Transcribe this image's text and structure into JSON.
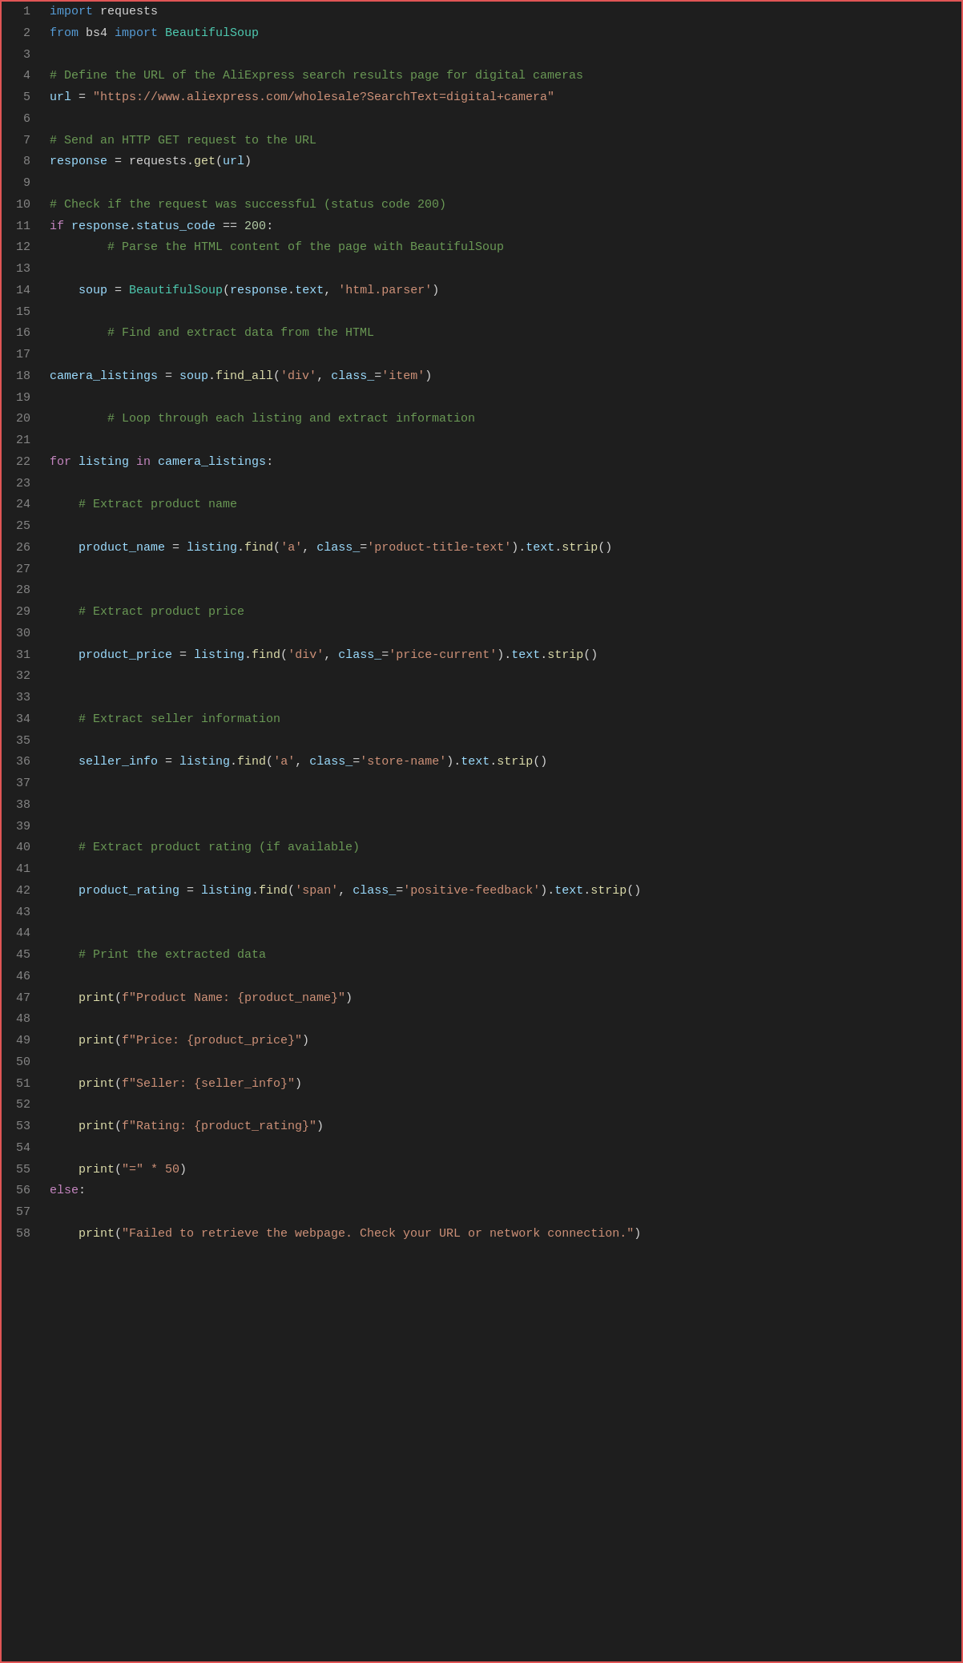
{
  "editor": {
    "background": "#1e1e1e",
    "border_color": "#e05555",
    "lines": [
      {
        "num": 1,
        "tokens": [
          {
            "t": "kw",
            "v": "import"
          },
          {
            "t": "plain",
            "v": " requests"
          }
        ]
      },
      {
        "num": 2,
        "tokens": [
          {
            "t": "kw",
            "v": "from"
          },
          {
            "t": "plain",
            "v": " bs4 "
          },
          {
            "t": "kw",
            "v": "import"
          },
          {
            "t": "plain",
            "v": " "
          },
          {
            "t": "cls",
            "v": "BeautifulSoup"
          }
        ]
      },
      {
        "num": 3,
        "tokens": []
      },
      {
        "num": 4,
        "tokens": [
          {
            "t": "cmt",
            "v": "# Define the URL of the AliExpress search results page for digital cameras"
          }
        ]
      },
      {
        "num": 5,
        "tokens": [
          {
            "t": "var",
            "v": "url"
          },
          {
            "t": "plain",
            "v": " = "
          },
          {
            "t": "str",
            "v": "\"https://www.aliexpress.com/wholesale?SearchText=digital+camera\""
          }
        ]
      },
      {
        "num": 6,
        "tokens": []
      },
      {
        "num": 7,
        "tokens": [
          {
            "t": "cmt",
            "v": "# Send an HTTP GET request to the URL"
          }
        ]
      },
      {
        "num": 8,
        "tokens": [
          {
            "t": "var",
            "v": "response"
          },
          {
            "t": "plain",
            "v": " = requests."
          },
          {
            "t": "fn",
            "v": "get"
          },
          {
            "t": "plain",
            "v": "("
          },
          {
            "t": "var",
            "v": "url"
          },
          {
            "t": "plain",
            "v": ")"
          }
        ]
      },
      {
        "num": 9,
        "tokens": []
      },
      {
        "num": 10,
        "tokens": [
          {
            "t": "cmt",
            "v": "# Check if the request was successful (status code 200)"
          }
        ]
      },
      {
        "num": 11,
        "tokens": [
          {
            "t": "kw2",
            "v": "if"
          },
          {
            "t": "plain",
            "v": " "
          },
          {
            "t": "var",
            "v": "response"
          },
          {
            "t": "plain",
            "v": "."
          },
          {
            "t": "var",
            "v": "status_code"
          },
          {
            "t": "plain",
            "v": " == "
          },
          {
            "t": "num",
            "v": "200"
          },
          {
            "t": "plain",
            "v": ":"
          }
        ]
      },
      {
        "num": 12,
        "tokens": [
          {
            "t": "plain",
            "v": "        "
          },
          {
            "t": "cmt",
            "v": "# Parse the HTML content of the page with BeautifulSoup"
          }
        ]
      },
      {
        "num": 13,
        "tokens": []
      },
      {
        "num": 14,
        "tokens": [
          {
            "t": "plain",
            "v": "    "
          },
          {
            "t": "var",
            "v": "soup"
          },
          {
            "t": "plain",
            "v": " = "
          },
          {
            "t": "cls",
            "v": "BeautifulSoup"
          },
          {
            "t": "plain",
            "v": "("
          },
          {
            "t": "var",
            "v": "response"
          },
          {
            "t": "plain",
            "v": "."
          },
          {
            "t": "var",
            "v": "text"
          },
          {
            "t": "plain",
            "v": ", "
          },
          {
            "t": "str",
            "v": "'html.parser'"
          },
          {
            "t": "plain",
            "v": ")"
          }
        ]
      },
      {
        "num": 15,
        "tokens": []
      },
      {
        "num": 16,
        "tokens": [
          {
            "t": "plain",
            "v": "        "
          },
          {
            "t": "cmt",
            "v": "# Find and extract data from the HTML"
          }
        ]
      },
      {
        "num": 17,
        "tokens": []
      },
      {
        "num": 18,
        "tokens": [
          {
            "t": "var",
            "v": "camera_listings"
          },
          {
            "t": "plain",
            "v": " = "
          },
          {
            "t": "var",
            "v": "soup"
          },
          {
            "t": "plain",
            "v": "."
          },
          {
            "t": "fn",
            "v": "find_all"
          },
          {
            "t": "plain",
            "v": "("
          },
          {
            "t": "str",
            "v": "'div'"
          },
          {
            "t": "plain",
            "v": ", "
          },
          {
            "t": "var",
            "v": "class_"
          },
          {
            "t": "plain",
            "v": "="
          },
          {
            "t": "str",
            "v": "'item'"
          },
          {
            "t": "plain",
            "v": ")"
          }
        ]
      },
      {
        "num": 19,
        "tokens": []
      },
      {
        "num": 20,
        "tokens": [
          {
            "t": "plain",
            "v": "        "
          },
          {
            "t": "cmt",
            "v": "# Loop through each listing and extract information"
          }
        ]
      },
      {
        "num": 21,
        "tokens": []
      },
      {
        "num": 22,
        "tokens": [
          {
            "t": "kw2",
            "v": "for"
          },
          {
            "t": "plain",
            "v": " "
          },
          {
            "t": "var",
            "v": "listing"
          },
          {
            "t": "plain",
            "v": " "
          },
          {
            "t": "kw2",
            "v": "in"
          },
          {
            "t": "plain",
            "v": " "
          },
          {
            "t": "var",
            "v": "camera_listings"
          },
          {
            "t": "plain",
            "v": ":"
          }
        ]
      },
      {
        "num": 23,
        "tokens": []
      },
      {
        "num": 24,
        "tokens": [
          {
            "t": "plain",
            "v": "    "
          },
          {
            "t": "cmt",
            "v": "# Extract product name"
          }
        ]
      },
      {
        "num": 25,
        "tokens": []
      },
      {
        "num": 26,
        "tokens": [
          {
            "t": "plain",
            "v": "    "
          },
          {
            "t": "var",
            "v": "product_name"
          },
          {
            "t": "plain",
            "v": " = "
          },
          {
            "t": "var",
            "v": "listing"
          },
          {
            "t": "plain",
            "v": "."
          },
          {
            "t": "fn",
            "v": "find"
          },
          {
            "t": "plain",
            "v": "("
          },
          {
            "t": "str",
            "v": "'a'"
          },
          {
            "t": "plain",
            "v": ", "
          },
          {
            "t": "var",
            "v": "class_"
          },
          {
            "t": "plain",
            "v": "="
          },
          {
            "t": "str",
            "v": "'product-title-text'"
          },
          {
            "t": "plain",
            "v": ")."
          },
          {
            "t": "var",
            "v": "text"
          },
          {
            "t": "plain",
            "v": "."
          },
          {
            "t": "fn",
            "v": "strip"
          },
          {
            "t": "plain",
            "v": "()"
          }
        ]
      },
      {
        "num": 27,
        "tokens": []
      },
      {
        "num": 28,
        "tokens": []
      },
      {
        "num": 29,
        "tokens": [
          {
            "t": "plain",
            "v": "    "
          },
          {
            "t": "cmt",
            "v": "# Extract product price"
          }
        ]
      },
      {
        "num": 30,
        "tokens": []
      },
      {
        "num": 31,
        "tokens": [
          {
            "t": "plain",
            "v": "    "
          },
          {
            "t": "var",
            "v": "product_price"
          },
          {
            "t": "plain",
            "v": " = "
          },
          {
            "t": "var",
            "v": "listing"
          },
          {
            "t": "plain",
            "v": "."
          },
          {
            "t": "fn",
            "v": "find"
          },
          {
            "t": "plain",
            "v": "("
          },
          {
            "t": "str",
            "v": "'div'"
          },
          {
            "t": "plain",
            "v": ", "
          },
          {
            "t": "var",
            "v": "class_"
          },
          {
            "t": "plain",
            "v": "="
          },
          {
            "t": "str",
            "v": "'price-current'"
          },
          {
            "t": "plain",
            "v": ")."
          },
          {
            "t": "var",
            "v": "text"
          },
          {
            "t": "plain",
            "v": "."
          },
          {
            "t": "fn",
            "v": "strip"
          },
          {
            "t": "plain",
            "v": "()"
          }
        ]
      },
      {
        "num": 32,
        "tokens": []
      },
      {
        "num": 33,
        "tokens": []
      },
      {
        "num": 34,
        "tokens": [
          {
            "t": "plain",
            "v": "    "
          },
          {
            "t": "cmt",
            "v": "# Extract seller information"
          }
        ]
      },
      {
        "num": 35,
        "tokens": []
      },
      {
        "num": 36,
        "tokens": [
          {
            "t": "plain",
            "v": "    "
          },
          {
            "t": "var",
            "v": "seller_info"
          },
          {
            "t": "plain",
            "v": " = "
          },
          {
            "t": "var",
            "v": "listing"
          },
          {
            "t": "plain",
            "v": "."
          },
          {
            "t": "fn",
            "v": "find"
          },
          {
            "t": "plain",
            "v": "("
          },
          {
            "t": "str",
            "v": "'a'"
          },
          {
            "t": "plain",
            "v": ", "
          },
          {
            "t": "var",
            "v": "class_"
          },
          {
            "t": "plain",
            "v": "="
          },
          {
            "t": "str",
            "v": "'store-name'"
          },
          {
            "t": "plain",
            "v": ")."
          },
          {
            "t": "var",
            "v": "text"
          },
          {
            "t": "plain",
            "v": "."
          },
          {
            "t": "fn",
            "v": "strip"
          },
          {
            "t": "plain",
            "v": "()"
          }
        ]
      },
      {
        "num": 37,
        "tokens": []
      },
      {
        "num": 38,
        "tokens": []
      },
      {
        "num": 39,
        "tokens": []
      },
      {
        "num": 40,
        "tokens": [
          {
            "t": "plain",
            "v": "    "
          },
          {
            "t": "cmt",
            "v": "# Extract product rating (if available)"
          }
        ]
      },
      {
        "num": 41,
        "tokens": []
      },
      {
        "num": 42,
        "tokens": [
          {
            "t": "plain",
            "v": "    "
          },
          {
            "t": "var",
            "v": "product_rating"
          },
          {
            "t": "plain",
            "v": " = "
          },
          {
            "t": "var",
            "v": "listing"
          },
          {
            "t": "plain",
            "v": "."
          },
          {
            "t": "fn",
            "v": "find"
          },
          {
            "t": "plain",
            "v": "("
          },
          {
            "t": "str",
            "v": "'span'"
          },
          {
            "t": "plain",
            "v": ", "
          },
          {
            "t": "var",
            "v": "class_"
          },
          {
            "t": "plain",
            "v": "="
          },
          {
            "t": "str",
            "v": "'positive-feedback'"
          },
          {
            "t": "plain",
            "v": ")."
          },
          {
            "t": "var",
            "v": "text"
          },
          {
            "t": "plain",
            "v": "."
          },
          {
            "t": "fn",
            "v": "strip"
          },
          {
            "t": "plain",
            "v": "()"
          }
        ]
      },
      {
        "num": 43,
        "tokens": []
      },
      {
        "num": 44,
        "tokens": []
      },
      {
        "num": 45,
        "tokens": [
          {
            "t": "plain",
            "v": "    "
          },
          {
            "t": "cmt",
            "v": "# Print the extracted data"
          }
        ]
      },
      {
        "num": 46,
        "tokens": []
      },
      {
        "num": 47,
        "tokens": [
          {
            "t": "plain",
            "v": "    "
          },
          {
            "t": "fn",
            "v": "print"
          },
          {
            "t": "plain",
            "v": "("
          },
          {
            "t": "str2",
            "v": "f\"Product Name: {product_name}\""
          },
          {
            "t": "plain",
            "v": ")"
          }
        ]
      },
      {
        "num": 48,
        "tokens": []
      },
      {
        "num": 49,
        "tokens": [
          {
            "t": "plain",
            "v": "    "
          },
          {
            "t": "fn",
            "v": "print"
          },
          {
            "t": "plain",
            "v": "("
          },
          {
            "t": "str2",
            "v": "f\"Price: {product_price}\""
          },
          {
            "t": "plain",
            "v": ")"
          }
        ]
      },
      {
        "num": 50,
        "tokens": []
      },
      {
        "num": 51,
        "tokens": [
          {
            "t": "plain",
            "v": "    "
          },
          {
            "t": "fn",
            "v": "print"
          },
          {
            "t": "plain",
            "v": "("
          },
          {
            "t": "str2",
            "v": "f\"Seller: {seller_info}\""
          },
          {
            "t": "plain",
            "v": ")"
          }
        ]
      },
      {
        "num": 52,
        "tokens": []
      },
      {
        "num": 53,
        "tokens": [
          {
            "t": "plain",
            "v": "    "
          },
          {
            "t": "fn",
            "v": "print"
          },
          {
            "t": "plain",
            "v": "("
          },
          {
            "t": "str2",
            "v": "f\"Rating: {product_rating}\""
          },
          {
            "t": "plain",
            "v": ")"
          }
        ]
      },
      {
        "num": 54,
        "tokens": []
      },
      {
        "num": 55,
        "tokens": [
          {
            "t": "plain",
            "v": "    "
          },
          {
            "t": "fn",
            "v": "print"
          },
          {
            "t": "plain",
            "v": "("
          },
          {
            "t": "str",
            "v": "\"=\" * 50"
          },
          {
            "t": "plain",
            "v": ")"
          }
        ]
      },
      {
        "num": 56,
        "tokens": [
          {
            "t": "kw2",
            "v": "else"
          },
          {
            "t": "plain",
            "v": ":"
          }
        ]
      },
      {
        "num": 57,
        "tokens": []
      },
      {
        "num": 58,
        "tokens": [
          {
            "t": "plain",
            "v": "    "
          },
          {
            "t": "fn",
            "v": "print"
          },
          {
            "t": "plain",
            "v": "("
          },
          {
            "t": "str",
            "v": "\"Failed to retrieve the webpage. Check your URL or network connection.\""
          },
          {
            "t": "plain",
            "v": ")"
          }
        ]
      }
    ]
  }
}
